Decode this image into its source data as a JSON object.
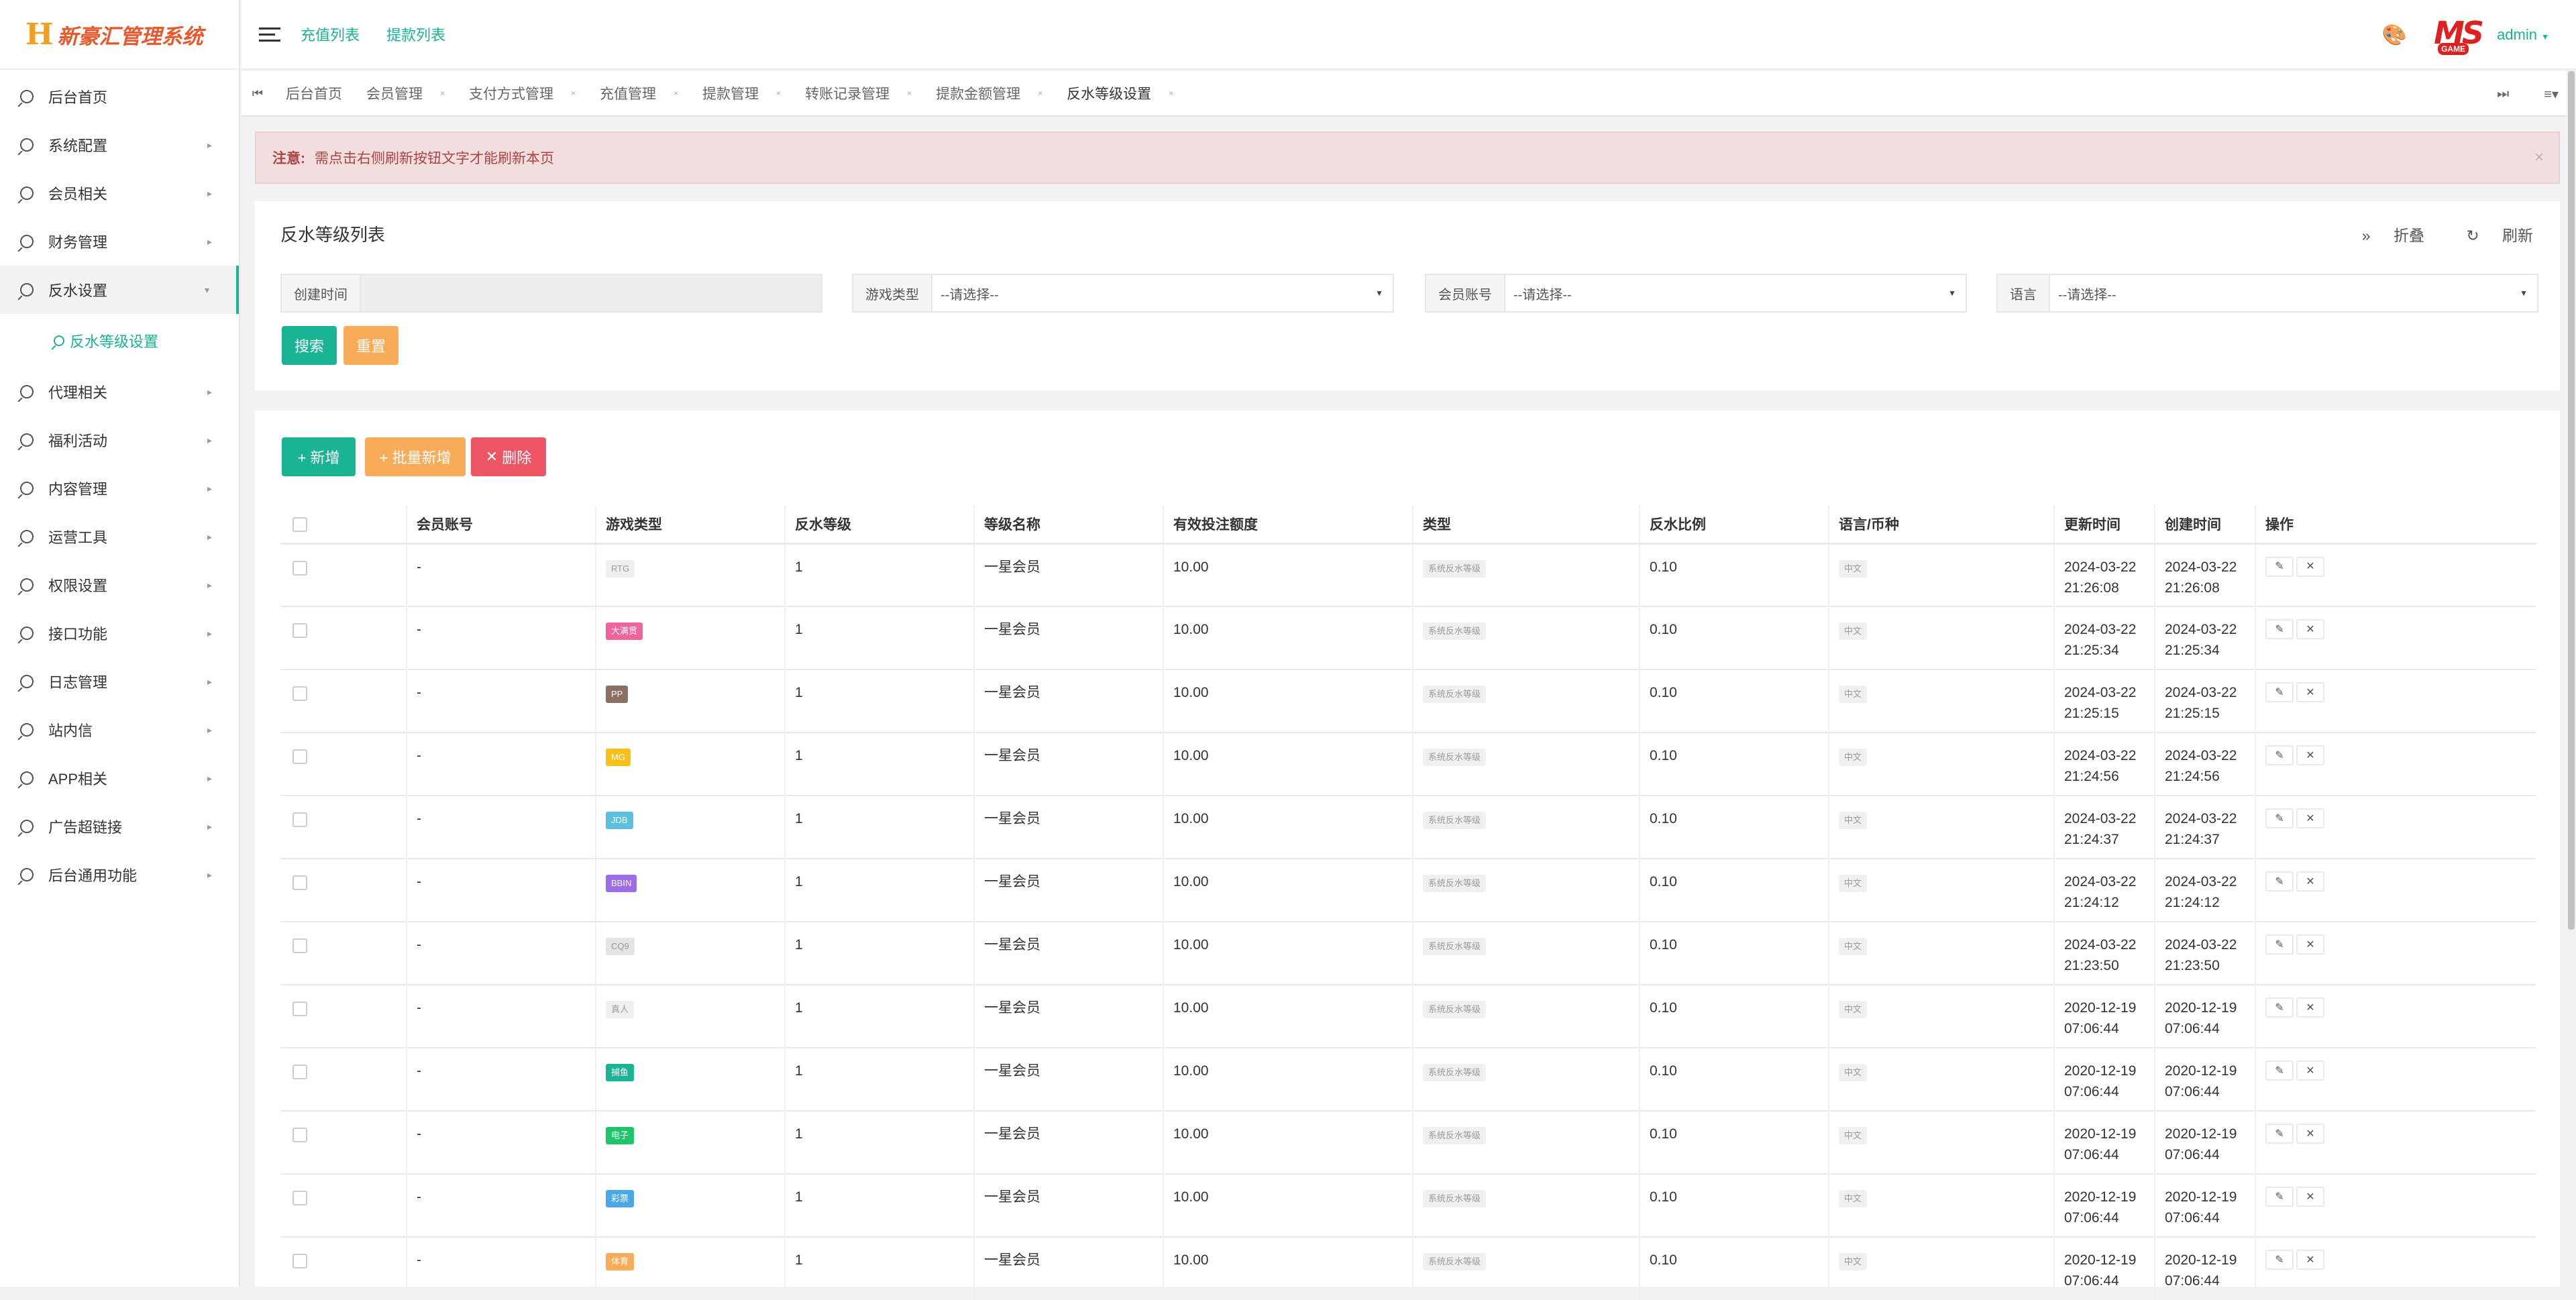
{
  "app": {
    "logo_mark": "H",
    "logo_text": "新豪汇管理系统"
  },
  "sidebar": {
    "items": [
      {
        "label": "后台首页",
        "arrow": false
      },
      {
        "label": "系统配置",
        "arrow": true
      },
      {
        "label": "会员相关",
        "arrow": true
      },
      {
        "label": "财务管理",
        "arrow": true
      },
      {
        "label": "反水设置",
        "arrow": true,
        "active": true
      },
      {
        "label": "代理相关",
        "arrow": true
      },
      {
        "label": "福利活动",
        "arrow": true
      },
      {
        "label": "内容管理",
        "arrow": true
      },
      {
        "label": "运营工具",
        "arrow": true
      },
      {
        "label": "权限设置",
        "arrow": true
      },
      {
        "label": "接口功能",
        "arrow": true
      },
      {
        "label": "日志管理",
        "arrow": true
      },
      {
        "label": "站内信",
        "arrow": true
      },
      {
        "label": "APP相关",
        "arrow": true
      },
      {
        "label": "广告超链接",
        "arrow": true
      },
      {
        "label": "后台通用功能",
        "arrow": true
      }
    ],
    "sub_item": "反水等级设置"
  },
  "topbar": {
    "links": [
      "充值列表",
      "提款列表"
    ],
    "brand_ms": "MS",
    "brand_game": "GAME",
    "user": "admin"
  },
  "tabs": [
    "后台首页",
    "会员管理",
    "支付方式管理",
    "充值管理",
    "提款管理",
    "转账记录管理",
    "提款金额管理",
    "反水等级设置"
  ],
  "alert": {
    "prefix": "注意:",
    "message": "需点击右侧刷新按钮文字才能刷新本页"
  },
  "panel": {
    "title": "反水等级列表",
    "collapse": "折叠",
    "refresh": "刷新",
    "filters": {
      "created_time": {
        "label": "创建时间",
        "value": ""
      },
      "game_type": {
        "label": "游戏类型",
        "value": "--请选择--"
      },
      "member_account": {
        "label": "会员账号",
        "value": "--请选择--"
      },
      "language": {
        "label": "语言",
        "value": "--请选择--"
      }
    },
    "search": "搜索",
    "reset": "重置"
  },
  "toolbar": {
    "add": "+ 新增",
    "batch_add": "+ 批量新增",
    "delete": "删除"
  },
  "table": {
    "headers": [
      "会员账号",
      "游戏类型",
      "反水等级",
      "等级名称",
      "有效投注额度",
      "类型",
      "反水比例",
      "语言/币种",
      "更新时间",
      "创建时间",
      "操作"
    ],
    "rows": [
      {
        "member": "-",
        "game": "RTG",
        "game_color": "#eef0f2",
        "level": "1",
        "name": "一星会员",
        "bet": "10.00",
        "type": "系统反水等级",
        "ratio": "0.10",
        "lang": "中文",
        "updated_d": "2024-03-22",
        "updated_t": "21:26:08",
        "created_d": "2024-03-22",
        "created_t": "21:26:08"
      },
      {
        "member": "-",
        "game": "大满贯",
        "game_color": "#f0649c",
        "level": "1",
        "name": "一星会员",
        "bet": "10.00",
        "type": "系统反水等级",
        "ratio": "0.10",
        "lang": "中文",
        "updated_d": "2024-03-22",
        "updated_t": "21:25:34",
        "created_d": "2024-03-22",
        "created_t": "21:25:34"
      },
      {
        "member": "-",
        "game": "PP",
        "game_color": "#8d6e63",
        "level": "1",
        "name": "一星会员",
        "bet": "10.00",
        "type": "系统反水等级",
        "ratio": "0.10",
        "lang": "中文",
        "updated_d": "2024-03-22",
        "updated_t": "21:25:15",
        "created_d": "2024-03-22",
        "created_t": "21:25:15"
      },
      {
        "member": "-",
        "game": "MG",
        "game_color": "#f8c118",
        "level": "1",
        "name": "一星会员",
        "bet": "10.00",
        "type": "系统反水等级",
        "ratio": "0.10",
        "lang": "中文",
        "updated_d": "2024-03-22",
        "updated_t": "21:24:56",
        "created_d": "2024-03-22",
        "created_t": "21:24:56"
      },
      {
        "member": "-",
        "game": "JDB",
        "game_color": "#5bc0de",
        "level": "1",
        "name": "一星会员",
        "bet": "10.00",
        "type": "系统反水等级",
        "ratio": "0.10",
        "lang": "中文",
        "updated_d": "2024-03-22",
        "updated_t": "21:24:37",
        "created_d": "2024-03-22",
        "created_t": "21:24:37"
      },
      {
        "member": "-",
        "game": "BBIN",
        "game_color": "#9b6ee8",
        "level": "1",
        "name": "一星会员",
        "bet": "10.00",
        "type": "系统反水等级",
        "ratio": "0.10",
        "lang": "中文",
        "updated_d": "2024-03-22",
        "updated_t": "21:24:12",
        "created_d": "2024-03-22",
        "created_t": "21:24:12"
      },
      {
        "member": "-",
        "game": "CQ9",
        "game_color": "#e4e4e4",
        "level": "1",
        "name": "一星会员",
        "bet": "10.00",
        "type": "系统反水等级",
        "ratio": "0.10",
        "lang": "中文",
        "updated_d": "2024-03-22",
        "updated_t": "21:23:50",
        "created_d": "2024-03-22",
        "created_t": "21:23:50"
      },
      {
        "member": "-",
        "game": "真人",
        "game_color": "#eef0f2",
        "level": "1",
        "name": "一星会员",
        "bet": "10.00",
        "type": "系统反水等级",
        "ratio": "0.10",
        "lang": "中文",
        "updated_d": "2020-12-19",
        "updated_t": "07:06:44",
        "created_d": "2020-12-19",
        "created_t": "07:06:44"
      },
      {
        "member": "-",
        "game": "捕鱼",
        "game_color": "#1ab394",
        "level": "1",
        "name": "一星会员",
        "bet": "10.00",
        "type": "系统反水等级",
        "ratio": "0.10",
        "lang": "中文",
        "updated_d": "2020-12-19",
        "updated_t": "07:06:44",
        "created_d": "2020-12-19",
        "created_t": "07:06:44"
      },
      {
        "member": "-",
        "game": "电子",
        "game_color": "#1ec56a",
        "level": "1",
        "name": "一星会员",
        "bet": "10.00",
        "type": "系统反水等级",
        "ratio": "0.10",
        "lang": "中文",
        "updated_d": "2020-12-19",
        "updated_t": "07:06:44",
        "created_d": "2020-12-19",
        "created_t": "07:06:44"
      },
      {
        "member": "-",
        "game": "彩票",
        "game_color": "#4aa8e8",
        "level": "1",
        "name": "一星会员",
        "bet": "10.00",
        "type": "系统反水等级",
        "ratio": "0.10",
        "lang": "中文",
        "updated_d": "2020-12-19",
        "updated_t": "07:06:44",
        "created_d": "2020-12-19",
        "created_t": "07:06:44"
      },
      {
        "member": "-",
        "game": "体育",
        "game_color": "#f8ac59",
        "level": "1",
        "name": "一星会员",
        "bet": "10.00",
        "type": "系统反水等级",
        "ratio": "0.10",
        "lang": "中文",
        "updated_d": "2020-12-19",
        "updated_t": "07:06:44",
        "created_d": "2020-12-19",
        "created_t": "07:06:44"
      }
    ],
    "edit_icon": "pencil-icon",
    "delete_icon": "x-icon"
  },
  "colors": {
    "accent": "#1ab394",
    "warning": "#f8ac59",
    "danger": "#ed5565",
    "alert_bg": "#f2dede"
  }
}
